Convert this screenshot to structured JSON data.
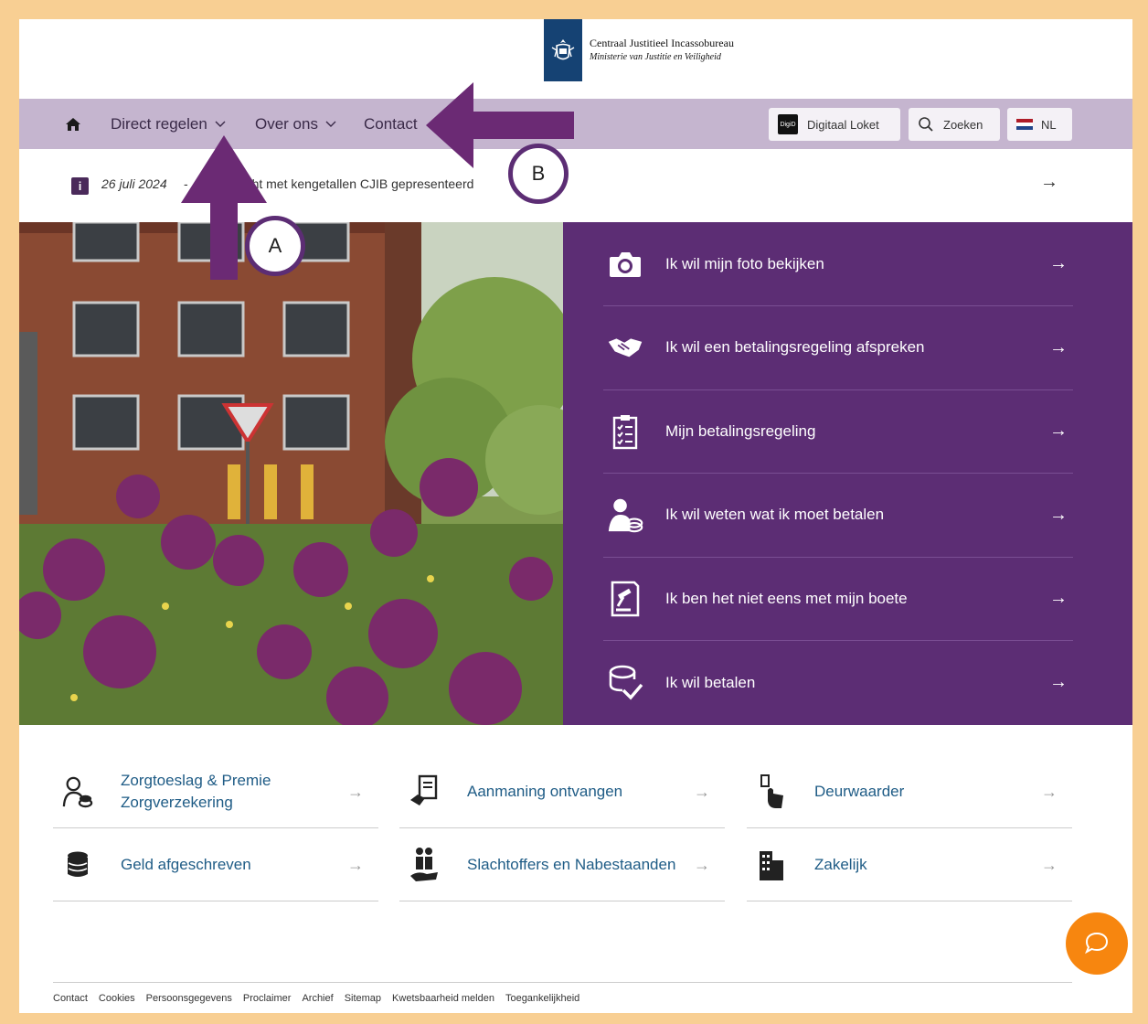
{
  "header": {
    "org_title": "Centraal Justitieel Incassobureau",
    "org_subtitle": "Ministerie van Justitie en Veiligheid"
  },
  "nav": {
    "direct_regelen": "Direct regelen",
    "over_ons": "Over ons",
    "contact": "Contact",
    "digitaal_loket": "Digitaal Loket",
    "digid_badge": "DigiD",
    "zoeken": "Zoeken",
    "language": "NL"
  },
  "news": {
    "date": "26 juli 2024",
    "separator": "-",
    "text": "Jaarbericht met kengetallen CJIB gepresenteerd",
    "arrow": "→"
  },
  "tasks": [
    {
      "label": "Ik wil mijn foto bekijken",
      "icon": "camera-icon"
    },
    {
      "label": "Ik wil een betalingsregeling afspreken",
      "icon": "handshake-icon"
    },
    {
      "label": "Mijn betalingsregeling",
      "icon": "clipboard-checklist-icon"
    },
    {
      "label": "Ik wil weten wat ik moet betalen",
      "icon": "person-coins-icon"
    },
    {
      "label": "Ik ben het niet eens met mijn boete",
      "icon": "gavel-document-icon"
    },
    {
      "label": "Ik wil betalen",
      "icon": "coins-check-icon"
    }
  ],
  "links": [
    {
      "label": "Zorgtoeslag & Premie Zorgverzekering",
      "icon": "person-coins-icon"
    },
    {
      "label": "Aanmaning ontvangen",
      "icon": "hand-document-icon"
    },
    {
      "label": "Deurwaarder",
      "icon": "doorbell-icon"
    },
    {
      "label": "Geld afgeschreven",
      "icon": "coin-stack-icon"
    },
    {
      "label": "Slachtoffers en Nabestaanden",
      "icon": "people-hand-icon"
    },
    {
      "label": "Zakelijk",
      "icon": "building-icon"
    }
  ],
  "arrow_glyph": "→",
  "footer": [
    "Contact",
    "Cookies",
    "Persoonsgegevens",
    "Proclaimer",
    "Archief",
    "Sitemap",
    "Kwetsbaarheid melden",
    "Toegankelijkheid"
  ],
  "annotations": {
    "a": "A",
    "b": "B"
  },
  "colors": {
    "frame": "#f8cf93",
    "nav": "#c5b5cf",
    "panel": "#5c2d74",
    "link": "#1f5c86",
    "chat": "#f7860f",
    "arrow": "#6b2a74"
  }
}
